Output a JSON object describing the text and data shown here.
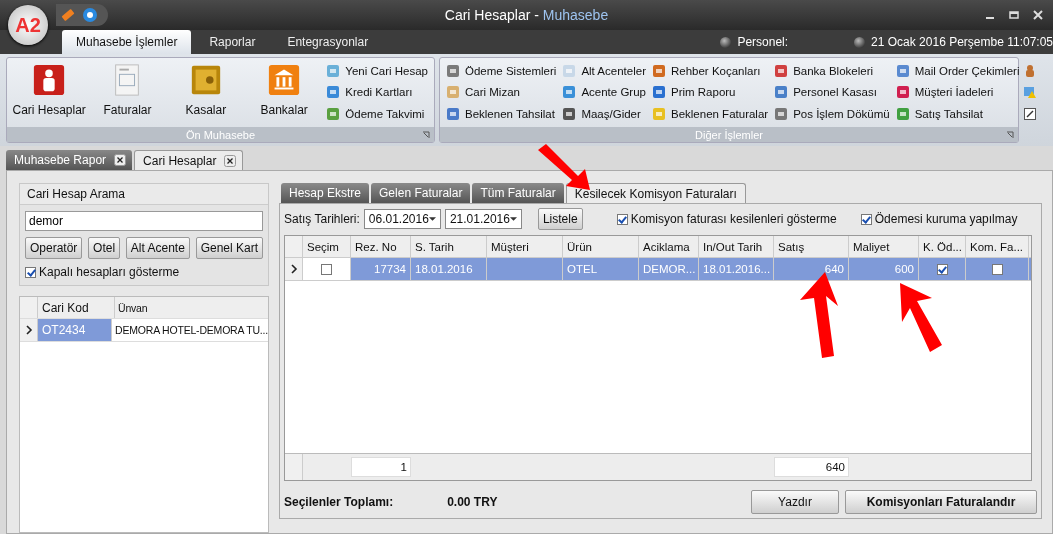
{
  "window": {
    "logo": "A2",
    "title": "Cari Hesaplar -",
    "subtitle": "Muhasebe"
  },
  "ribbon_tabs": [
    {
      "label": "Muhasebe İşlemler",
      "selected": true
    },
    {
      "label": "Raporlar",
      "selected": false
    },
    {
      "label": "Entegrasyonlar",
      "selected": false
    }
  ],
  "status": {
    "personel_label": "Personel:",
    "datetime": "21 Ocak 2016 Perşembe 11:07:05"
  },
  "ribbon_groups": [
    {
      "title": "Ön Muhasebe",
      "large_buttons": [
        "Cari Hesaplar",
        "Faturalar",
        "Kasalar",
        "Bankalar"
      ],
      "small_columns": [
        [
          "Yeni Cari Hesap",
          "Kredi Kartları",
          "Ödeme Takvimi"
        ]
      ]
    },
    {
      "title": "Diğer İşlemler",
      "small_columns": [
        [
          "Ödeme Sistemleri",
          "Cari Mizan",
          "Beklenen Tahsilat"
        ],
        [
          "Alt Acenteler",
          "Acente Grup",
          "Maaş/Gider"
        ],
        [
          "Rehber Koçanları",
          "Prim Raporu",
          "Beklenen Faturalar"
        ],
        [
          "Banka Blokeleri",
          "Personel Kasası",
          "Pos İşlem Dökümü"
        ],
        [
          "Mail Order Çekimleri",
          "Müşteri İadeleri",
          "Satış Tahsilat"
        ]
      ]
    }
  ],
  "document_tabs": [
    {
      "label": "Muhasebe Rapor",
      "selected": false
    },
    {
      "label": "Cari Hesaplar",
      "selected": true
    }
  ],
  "search_panel": {
    "title": "Cari Hesap Arama",
    "value": "demor",
    "buttons": [
      "Operatör",
      "Otel",
      "Alt Acente",
      "Genel Kart"
    ],
    "checkbox": {
      "label": "Kapalı hesapları gösterme",
      "checked": true
    }
  },
  "accounts_table": {
    "columns": [
      "Cari Kod",
      "Ünvan"
    ],
    "rows": [
      {
        "selected": true,
        "cells": [
          "OT2434",
          "DEMORA HOTEL-DEMORA TU..."
        ]
      }
    ]
  },
  "detail_tabs": [
    {
      "label": "Hesap Ekstre",
      "selected": false
    },
    {
      "label": "Gelen Faturalar",
      "selected": false
    },
    {
      "label": "Tüm Faturalar",
      "selected": false
    },
    {
      "label": "Kesilecek Komisyon Faturaları",
      "selected": true
    }
  ],
  "filter": {
    "label": "Satış Tarihleri:",
    "date_from": "06.01.2016",
    "date_to": "21.01.2016",
    "button": "Listele",
    "checkboxes": [
      {
        "label": "Komisyon faturası kesilenleri gösterme",
        "checked": true
      },
      {
        "label": "Ödemesi kuruma yapılmay",
        "checked": true
      }
    ]
  },
  "invoice_table": {
    "columns": [
      {
        "label": "Seçim",
        "kind": "check"
      },
      {
        "label": "Rez. No",
        "kind": "number",
        "footer": "1"
      },
      {
        "label": "S. Tarih",
        "kind": "text"
      },
      {
        "label": "Müşteri",
        "kind": "text"
      },
      {
        "label": "Ürün",
        "kind": "text"
      },
      {
        "label": "Aciklama",
        "kind": "text"
      },
      {
        "label": "In/Out Tarih",
        "kind": "text"
      },
      {
        "label": "Satış",
        "kind": "number",
        "footer": "640"
      },
      {
        "label": "Maliyet",
        "kind": "number"
      },
      {
        "label": "K. Öd...",
        "kind": "check"
      },
      {
        "label": "Kom. Fa...",
        "kind": "check"
      }
    ],
    "rows": [
      {
        "selected": true,
        "cells": [
          {
            "checked": false
          },
          {
            "text": "17734"
          },
          {
            "text": "18.01.2016"
          },
          null,
          {
            "text": "OTEL"
          },
          {
            "text": "DEMOR..."
          },
          {
            "text": "18.01.2016..."
          },
          {
            "text": "640"
          },
          {
            "text": "600"
          },
          {
            "checked": true
          },
          {
            "checked": false
          }
        ]
      }
    ]
  },
  "summary": {
    "label": "Seçilenler Toplamı:",
    "value": "0.00 TRY"
  },
  "actions": [
    "Yazdır",
    "Komisyonları Faturalandır"
  ]
}
